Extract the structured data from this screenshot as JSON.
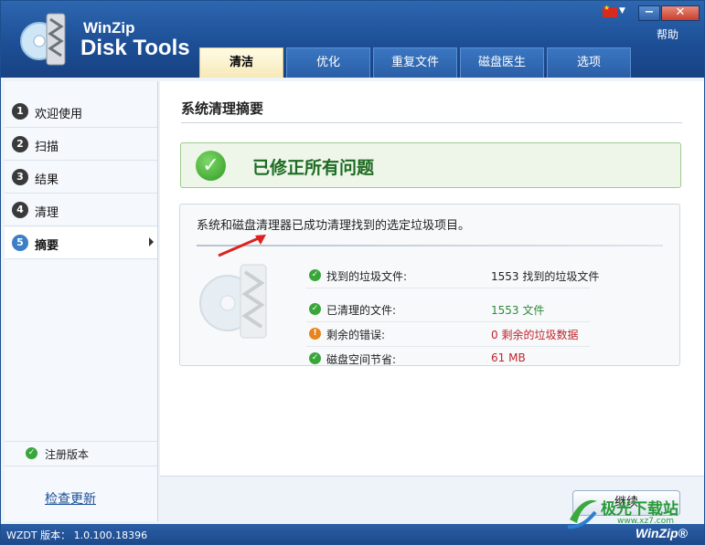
{
  "header": {
    "app_name_line1": "WinZip",
    "app_name_line2": "Disk Tools",
    "help_label": "帮助",
    "minimize_glyph": "−",
    "close_glyph": "✕",
    "tabs": [
      {
        "label": "清洁",
        "active": true
      },
      {
        "label": "优化",
        "active": false
      },
      {
        "label": "重复文件",
        "active": false
      },
      {
        "label": "磁盘医生",
        "active": false
      },
      {
        "label": "选项",
        "active": false
      }
    ]
  },
  "sidebar": {
    "steps": [
      {
        "num": "1",
        "label": "欢迎使用"
      },
      {
        "num": "2",
        "label": "扫描"
      },
      {
        "num": "3",
        "label": "结果"
      },
      {
        "num": "4",
        "label": "清理"
      },
      {
        "num": "5",
        "label": "摘要",
        "active": true
      }
    ],
    "registered_label": "注册版本",
    "check_update_label": "检查更新"
  },
  "main": {
    "title": "系统清理摘要",
    "banner_text": "已修正所有问题",
    "summary_text": "系统和磁盘清理器已成功清理找到的选定垃圾项目。",
    "rows": [
      {
        "icon": "check-icon",
        "label": "找到的垃圾文件:",
        "value": "1553 找到的垃圾文件",
        "color": "#222222"
      },
      {
        "icon": "check-icon",
        "label": "已清理的文件:",
        "value": "1553 文件",
        "color": "#2e8b3a"
      },
      {
        "icon": "warning-icon",
        "label": "剩余的错误:",
        "value": "0 剩余的垃圾数据",
        "color": "#c0262b"
      },
      {
        "icon": "check-icon",
        "label": "磁盘空间节省:",
        "value": "61 MB",
        "color": "#c0262b"
      }
    ],
    "continue_label": "继续"
  },
  "status": {
    "version": "WZDT 版本： 1.0.100.18396",
    "brand": "WinZip®"
  },
  "watermark": {
    "text": "极光下载站",
    "sub": "www.xz7.com"
  },
  "colors": {
    "header_blue": "#1d4f96",
    "success_green": "#2f9a22",
    "error_red": "#c0262b",
    "warning_orange": "#e8841c"
  }
}
